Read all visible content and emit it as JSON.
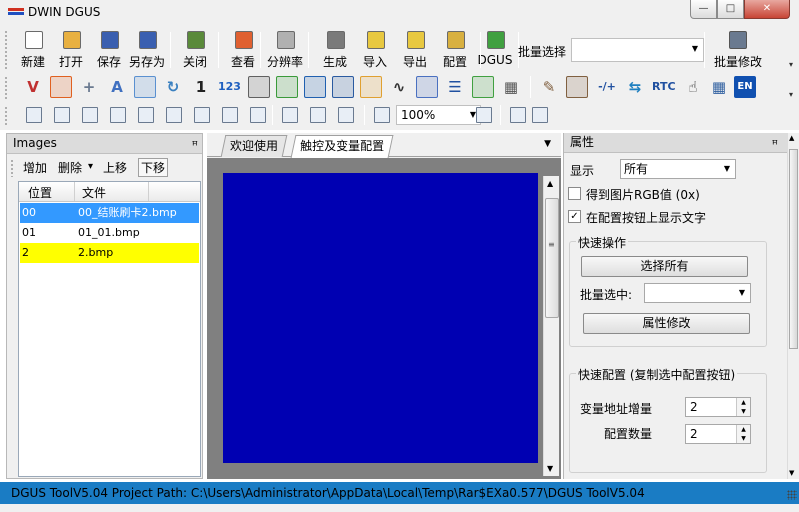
{
  "window": {
    "title": "DWIN DGUS",
    "min_label": "—",
    "max_label": "□",
    "close_label": "✕"
  },
  "toolbar_main": [
    {
      "id": "new",
      "label": "新建",
      "icon": "new-file-icon",
      "color": "#ffffff"
    },
    {
      "id": "open",
      "label": "打开",
      "icon": "open-folder-icon",
      "color": "#e8b040"
    },
    {
      "id": "save",
      "label": "保存",
      "icon": "save-icon",
      "color": "#3a5fb0"
    },
    {
      "id": "save-as",
      "label": "另存为",
      "icon": "save-as-icon",
      "color": "#3a5fb0"
    },
    {
      "id": "close",
      "label": "关闭",
      "icon": "close-project-icon",
      "color": "#5a8a3a"
    },
    {
      "id": "view",
      "label": "查看",
      "icon": "view-icon",
      "color": "#e06030"
    },
    {
      "id": "resolution",
      "label": "分辨率",
      "icon": "resolution-icon",
      "color": "#b0b0b0"
    },
    {
      "id": "generate",
      "label": "生成",
      "icon": "generate-icon",
      "color": "#7a7a7a"
    },
    {
      "id": "import",
      "label": "导入",
      "icon": "import-icon",
      "color": "#e8c840"
    },
    {
      "id": "export",
      "label": "导出",
      "icon": "export-icon",
      "color": "#e8c840"
    },
    {
      "id": "config",
      "label": "配置",
      "icon": "config-icon",
      "color": "#d8b040"
    },
    {
      "id": "dgus",
      "label": "DGUS",
      "icon": "dgus-download-icon",
      "color": "#40a040"
    }
  ],
  "batch_select": {
    "label": "批量选择",
    "value": "",
    "dropdown_arrow": "▼"
  },
  "batch_modify": {
    "label": "批量修改",
    "icon": "batch-modify-icon",
    "color": "#6a7a90"
  },
  "toolbar_controls": [
    {
      "icon": "variable-icon",
      "color": "#c03030",
      "glyph": "V"
    },
    {
      "icon": "icon-tool-icon",
      "color": "#e06020",
      "glyph": ""
    },
    {
      "icon": "increment-icon",
      "color": "#6a7a90",
      "glyph": "+"
    },
    {
      "icon": "slider-icon",
      "color": "#4070c0",
      "glyph": "A"
    },
    {
      "icon": "image-icon",
      "color": "#5a90d0",
      "glyph": ""
    },
    {
      "icon": "rotate-icon",
      "color": "#3a80c0",
      "glyph": "↻"
    },
    {
      "icon": "number-input-icon",
      "color": "#222222",
      "glyph": "1"
    },
    {
      "icon": "number-display-icon",
      "color": "#2060c0",
      "glyph": "123"
    },
    {
      "icon": "text-display-icon",
      "color": "#606060",
      "glyph": ""
    },
    {
      "icon": "data-transfer-icon",
      "color": "#3a9a3a",
      "glyph": ""
    },
    {
      "icon": "clock-icon",
      "color": "#2060b0",
      "glyph": ""
    },
    {
      "icon": "screen-icon",
      "color": "#2a5aa0",
      "glyph": ""
    },
    {
      "icon": "globe-icon",
      "color": "#e0a030",
      "glyph": ""
    },
    {
      "icon": "curve-icon",
      "color": "#333333",
      "glyph": "∿"
    },
    {
      "icon": "shape-icon",
      "color": "#4a70c0",
      "glyph": ""
    },
    {
      "icon": "list-icon",
      "color": "#2050a0",
      "glyph": "☰"
    },
    {
      "icon": "toggle-icon",
      "color": "#40a040",
      "glyph": ""
    },
    {
      "icon": "qr-code-icon",
      "color": "#555555",
      "glyph": "▦"
    },
    {
      "icon": "edit-icon",
      "color": "#806040",
      "glyph": "✎"
    },
    {
      "icon": "form-edit-icon",
      "color": "#806040",
      "glyph": ""
    },
    {
      "icon": "plus-minus-icon",
      "color": "#2050a0",
      "glyph": "-/+"
    },
    {
      "icon": "sync-icon",
      "color": "#2080c0",
      "glyph": "⇆"
    },
    {
      "icon": "rtc-icon",
      "color": "#2050a0",
      "glyph": "RTC"
    },
    {
      "icon": "touch-hand-icon",
      "color": "#333333",
      "glyph": "☝"
    },
    {
      "icon": "keyboard-grid-icon",
      "color": "#3060a0",
      "glyph": "▦"
    },
    {
      "icon": "language-en-icon",
      "color": "#1050b0",
      "glyph": "EN"
    }
  ],
  "toolbar_align": [
    "align-left-icon",
    "align-center-icon",
    "align-right-icon",
    "align-top-icon",
    "align-middle-icon",
    "align-bottom-icon",
    "center-both-icon",
    "same-width-icon",
    "same-height-icon",
    "copy-icon",
    "paste-icon",
    "delete-icon",
    "zoom-in-icon"
  ],
  "zoom": {
    "value": "100%",
    "dropdown_arrow": "▼",
    "after_icons": [
      "zoom-out-icon",
      "bring-front-icon",
      "send-back-icon"
    ]
  },
  "images_panel": {
    "title": "Images",
    "pin": "ꟸ",
    "buttons": {
      "add": "增加",
      "delete": "删除",
      "delete_arrow": "▾",
      "move_up": "上移",
      "move_down": "下移"
    },
    "columns": {
      "position": "位置",
      "file": "文件"
    },
    "rows": [
      {
        "position": "00",
        "file": "00_结账刷卡2.bmp",
        "state": "selected",
        "bg": "#3399ff",
        "fg": "#ffffff"
      },
      {
        "position": "01",
        "file": "01_01.bmp",
        "state": "normal",
        "bg": "#ffffff",
        "fg": "#000000"
      },
      {
        "position": "2",
        "file": "2.bmp",
        "state": "highlight",
        "bg": "#ffff00",
        "fg": "#000000"
      }
    ]
  },
  "tabs": [
    {
      "label": "欢迎使用",
      "active": false
    },
    {
      "label": "触控及变量配置",
      "active": true
    }
  ],
  "tab_menu_arrow": "▼",
  "canvas": {
    "color": "#0000b2"
  },
  "properties_panel": {
    "title": "属性",
    "display_label": "显示",
    "display_value": "所有",
    "get_rgb_label": "得到图片RGB值 (0x)",
    "get_rgb_checked": false,
    "show_text_label": "在配置按钮上显示文字",
    "show_text_checked": true,
    "quick_ops": {
      "title": "快速操作",
      "select_all": "选择所有",
      "batch_selected_label": "批量选中:",
      "batch_selected_value": "",
      "modify_button": "属性修改"
    },
    "quick_config": {
      "title": "快速配置 (复制选中配置按钮)",
      "var_increment_label": "变量地址增量",
      "var_increment_value": "2",
      "count_label": "配置数量",
      "count_value": "2"
    }
  },
  "statusbar": {
    "text": "DGUS ToolV5.04  Project Path: C:\\Users\\Administrator\\AppData\\Local\\Temp\\Rar$EXa0.577\\DGUS ToolV5.04",
    "bg": "#1a7cc4"
  }
}
